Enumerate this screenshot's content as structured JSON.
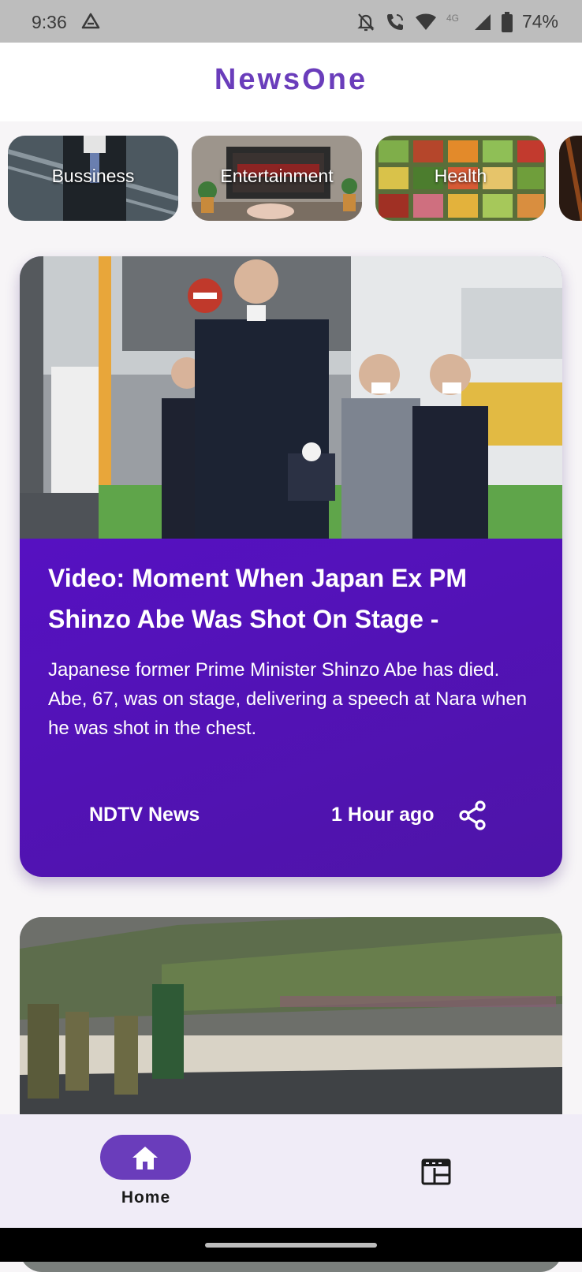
{
  "status_bar": {
    "time": "9:36",
    "battery": "74%",
    "icons": [
      "drive-icon",
      "bell-off-icon",
      "wifi-call-icon",
      "wifi-icon",
      "lte-4g-icon",
      "signal-icon",
      "battery-icon"
    ]
  },
  "header": {
    "title": "NewsOne"
  },
  "categories": [
    {
      "label": "Bussiness",
      "icon": "business-thumbnail"
    },
    {
      "label": "Entertainment",
      "icon": "entertainment-thumbnail"
    },
    {
      "label": "Health",
      "icon": "health-thumbnail"
    }
  ],
  "articles": [
    {
      "title": "Video: Moment When Japan Ex PM Shinzo Abe Was Shot On Stage -",
      "description": "Japanese former Prime Minister Shinzo Abe has died. Abe, 67, was on stage, delivering a speech at Nara when he was shot in the chest.",
      "source": "NDTV News",
      "time": "1 Hour ago",
      "share_icon": "share-icon"
    },
    {
      "image": "flood-rescue-photo"
    }
  ],
  "bottom_nav": {
    "items": [
      {
        "label": "Home",
        "icon": "home-icon",
        "active": true
      },
      {
        "label": "",
        "icon": "newspaper-icon",
        "active": false
      }
    ]
  },
  "colors": {
    "accent": "#6a3dbb",
    "card_gradient_start": "#5a0fcf",
    "card_gradient_end": "#4e14a8",
    "nav_background": "#f0ecf7"
  }
}
